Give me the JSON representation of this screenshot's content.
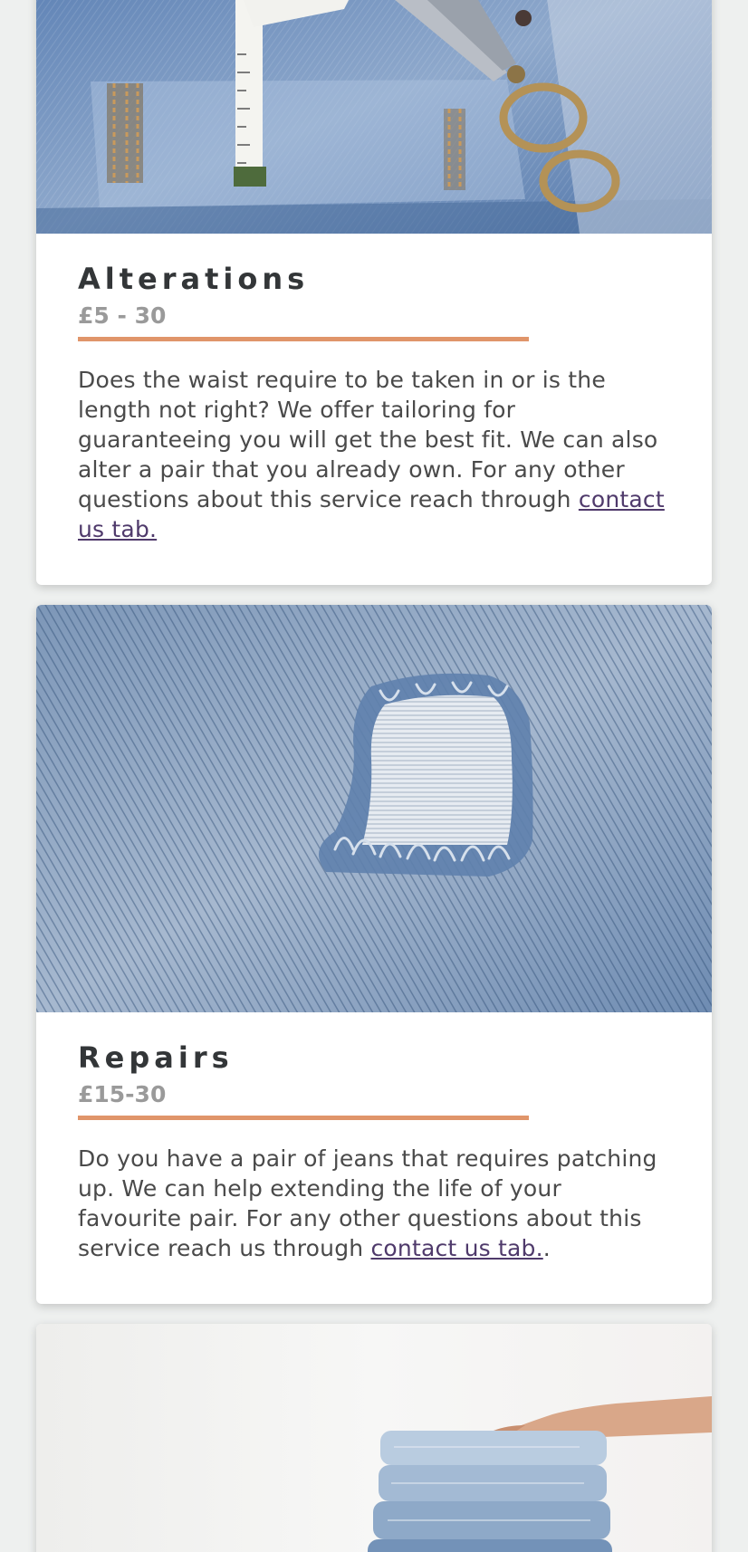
{
  "services": [
    {
      "title": "Alterations",
      "price": "£5 - 30",
      "description": "Does the waist require to be taken in or is the length not right? We offer tailoring for guaranteeing you will get the best fit. We can also alter a pair that you already own. For any other questions about this service reach through ",
      "link_text": "contact us tab.",
      "trailing": "",
      "image_name": "jeans-tape-measure-scissors-image"
    },
    {
      "title": "Repairs",
      "price": "£15-30",
      "description": "Do you have a pair of jeans that requires patching up. We can help extending the life of your favourite pair. For any other questions about this service reach us through ",
      "link_text": "contact us tab.",
      "trailing": ".",
      "image_name": "ripped-denim-image"
    },
    {
      "image_name": "folded-jeans-stack-image"
    }
  ],
  "colors": {
    "accent_rule": "#e0956a",
    "link": "#4f3a6b",
    "title": "#333638",
    "price": "#9a9a9a",
    "background": "#eef0ef"
  }
}
